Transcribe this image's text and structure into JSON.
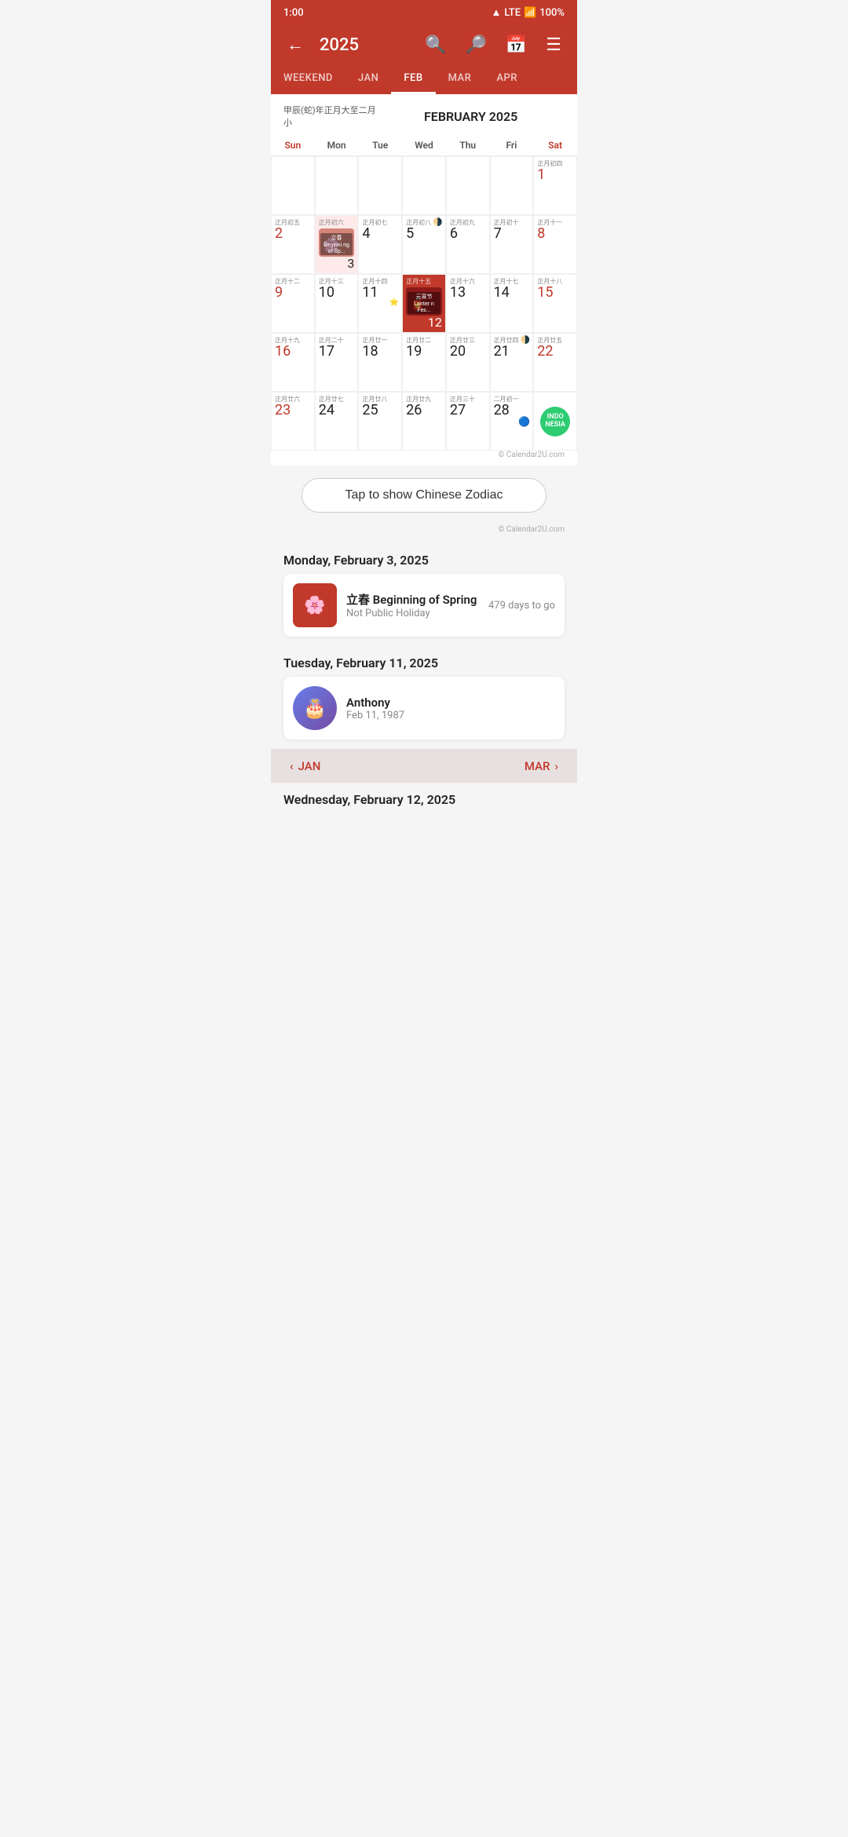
{
  "statusBar": {
    "time": "1:00",
    "wifi": "wifi",
    "lte": "LTE",
    "signal": "signal",
    "battery": "100%"
  },
  "header": {
    "year": "2025",
    "backIcon": "←",
    "searchIcon": "🔍",
    "zoomOutIcon": "🔎",
    "calendarIcon": "📅",
    "listIcon": "☰"
  },
  "tabs": [
    {
      "id": "weekend",
      "label": "WEEKEND",
      "active": false
    },
    {
      "id": "jan",
      "label": "JAN",
      "active": false
    },
    {
      "id": "feb",
      "label": "FEB",
      "active": true
    },
    {
      "id": "mar",
      "label": "MAR",
      "active": false
    },
    {
      "id": "apr",
      "label": "APR",
      "active": false
    }
  ],
  "calendar": {
    "lunarLabel": "甲辰(蛇)年正月大至二月小",
    "title": "FEBRUARY 2025",
    "dayHeaders": [
      "Sun",
      "Mon",
      "Tue",
      "Wed",
      "Thu",
      "Fri",
      "Sat"
    ],
    "copyright": "© Calendar2U.com",
    "weeks": [
      [
        {
          "day": null,
          "lunar": ""
        },
        {
          "day": null,
          "lunar": ""
        },
        {
          "day": null,
          "lunar": ""
        },
        {
          "day": null,
          "lunar": ""
        },
        {
          "day": null,
          "lunar": ""
        },
        {
          "day": null,
          "lunar": ""
        },
        {
          "day": "1",
          "lunar": "正月初四",
          "event": null
        }
      ],
      [
        {
          "day": "2",
          "lunar": "正月初五",
          "event": null
        },
        {
          "day": "3",
          "lunar": "正月初六",
          "event": "spring",
          "eventLabel": "立春 Beginni..."
        },
        {
          "day": "4",
          "lunar": "正月初七",
          "event": null
        },
        {
          "day": "5",
          "lunar": "正月初八",
          "moon": "half",
          "event": null
        },
        {
          "day": "6",
          "lunar": "正月初九",
          "event": null
        },
        {
          "day": "7",
          "lunar": "正月初十",
          "event": null
        },
        {
          "day": "8",
          "lunar": "正月十一",
          "event": null
        }
      ],
      [
        {
          "day": "9",
          "lunar": "正月十二",
          "event": null
        },
        {
          "day": "10",
          "lunar": "正月十三",
          "event": null
        },
        {
          "day": "11",
          "lunar": "正月十四",
          "event": null,
          "star": true
        },
        {
          "day": "12",
          "lunar": "正月十五",
          "event": "lantern",
          "eventLabel": "元宵节 Lantern Fes..."
        },
        {
          "day": "13",
          "lunar": "正月十六",
          "event": null
        },
        {
          "day": "14",
          "lunar": "正月十七",
          "event": null
        },
        {
          "day": "15",
          "lunar": "正月十八",
          "event": null
        }
      ],
      [
        {
          "day": "16",
          "lunar": "正月十九",
          "event": null
        },
        {
          "day": "17",
          "lunar": "正月二十",
          "event": null
        },
        {
          "day": "18",
          "lunar": "正月廿一",
          "event": null
        },
        {
          "day": "19",
          "lunar": "正月廿二",
          "event": null
        },
        {
          "day": "20",
          "lunar": "正月廿三",
          "event": null
        },
        {
          "day": "21",
          "lunar": "正月廿四",
          "moon": "half",
          "event": null
        },
        {
          "day": "22",
          "lunar": "正月廿五",
          "event": null
        }
      ],
      [
        {
          "day": "23",
          "lunar": "正月廿六",
          "event": null
        },
        {
          "day": "24",
          "lunar": "正月廿七",
          "event": null
        },
        {
          "day": "25",
          "lunar": "正月廿八",
          "event": null
        },
        {
          "day": "26",
          "lunar": "正月廿九",
          "event": null
        },
        {
          "day": "27",
          "lunar": "正月三十",
          "event": null
        },
        {
          "day": "28",
          "lunar": "二月初一",
          "event": null
        },
        {
          "day": null,
          "lunar": "",
          "event": "indonesia"
        }
      ]
    ]
  },
  "tapButton": {
    "label": "Tap to show Chinese Zodiac"
  },
  "eventSections": [
    {
      "dateLabel": "Monday, February 3, 2025",
      "events": [
        {
          "name": "立春 Beginning of Spring",
          "sub": "Not Public Holiday",
          "daysTo": "479 days to go",
          "emoji": "🌸",
          "type": "holiday"
        }
      ]
    },
    {
      "dateLabel": "Tuesday, February 11, 2025",
      "events": [
        {
          "name": "Anthony",
          "sub": "Feb 11, 1987",
          "daysTo": "",
          "emoji": "🎂",
          "type": "birthday"
        }
      ]
    }
  ],
  "nextSectionLabel": "Wednesday, February 12, 2025",
  "bottomNav": {
    "prevLabel": "JAN",
    "nextLabel": "MAR",
    "prevIcon": "‹",
    "nextIcon": "›"
  }
}
